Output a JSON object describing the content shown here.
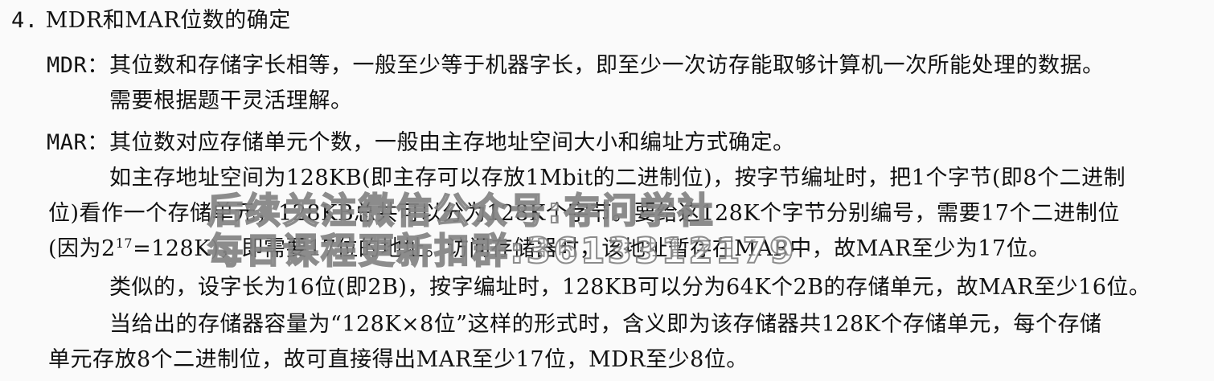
{
  "heading": {
    "number": "4.",
    "title": "MDR和MAR位数的确定"
  },
  "mdr": {
    "term": "MDR：",
    "line1": "其位数和存储字长相等，一般至少等于机器字长，即至少一次访存能取够计算机一次所能处理的数据。",
    "line2": "需要根据题干灵活理解。"
  },
  "mar": {
    "term": "MAR：",
    "line1": "其位数对应存储单元个数，一般由主存地址空间大小和编址方式确定。",
    "p1": {
      "line1": "如主存地址空间为128KB(即主存可以存放1Mbit的二进制位)，按字节编址时，把1个字节(即8个二进制",
      "line2": "位)看作一个存储单元，128KB总共可以分为128K个字节。要给这128K个字节分别编号，需要17个二进制位",
      "line3_pre": "(因为2",
      "line3_sup": "17",
      "line3_post": "=128K)，即需要17位的地址。访问存储器时，该地址暂存在MAR中，故MAR至少为17位。"
    },
    "p2": "类似的，设字长为16位(即2B)，按字编址时，128KB可以分为64K个2B的存储单元，故MAR至少16位。",
    "p3": {
      "line1": "当给出的存储器容量为“128K×8位”这样的形式时，含义即为该存储器共128K个存储单元，每个存储",
      "line2": "单元存放8个二进制位，故可直接得出MAR至少17位，MDR至少8位。"
    }
  },
  "watermark": {
    "line1": "后续关注微信公众号:存问学社",
    "line2": "每日课程更新扣群:3613312179"
  }
}
